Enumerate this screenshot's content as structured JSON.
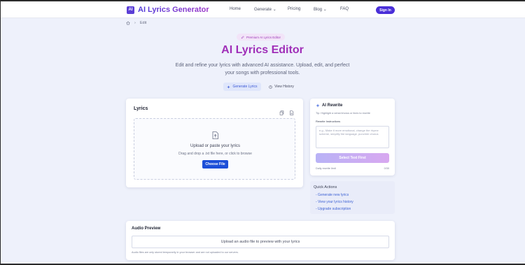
{
  "brand": {
    "badge": "AI",
    "name": "AI Lyrics Generator"
  },
  "nav": {
    "links": [
      "Home",
      "Generate",
      "Pricing",
      "Blog",
      "FAQ"
    ],
    "chevron": "⌄",
    "signin": "Sign In"
  },
  "breadcrumb": {
    "separator": "›",
    "current": "Edit"
  },
  "hero": {
    "badge": "Premium AI Lyrics Editor",
    "title": "AI Lyrics Editor",
    "subtitle": "Edit and refine your lyrics with advanced AI assistance. Upload, edit, and perfect your songs with professional tools.",
    "generate_label": "Generate Lyrics",
    "history_label": "View History"
  },
  "lyrics_card": {
    "title": "Lyrics",
    "upload_title": "Upload or paste your lyrics",
    "upload_hint": "Drag and drop a .txt file here, or click to browse",
    "choose_label": "Choose File"
  },
  "rewrite_card": {
    "title": "AI Rewrite",
    "tip": "Tip: Highlight a verse/chorus or lines to rewrite",
    "instructions_label": "Rewrite Instructions",
    "instructions_placeholder": "e.g., Make it more emotional, change the rhyme scheme, simplify the language, punchier chorus",
    "button_label": "Select Text First",
    "limit_label": "Daily rewrite limit",
    "limit_value": "0/30"
  },
  "quick_actions": {
    "title": "Quick Actions",
    "links": [
      "- Generate new lyrics",
      "- View your lyrics history",
      "- Upgrade subscription"
    ]
  },
  "audio_card": {
    "title": "Audio Preview",
    "upload_label": "Upload an audio file to preview with your lyrics",
    "note": "Audio files are only stored temporarily in your browser and are not uploaded to our servers."
  },
  "colors": {
    "brand": "#5b3fd6",
    "title": "#a02fb8",
    "primary_button": "#1d4fd8",
    "background": "#eef1fb"
  }
}
